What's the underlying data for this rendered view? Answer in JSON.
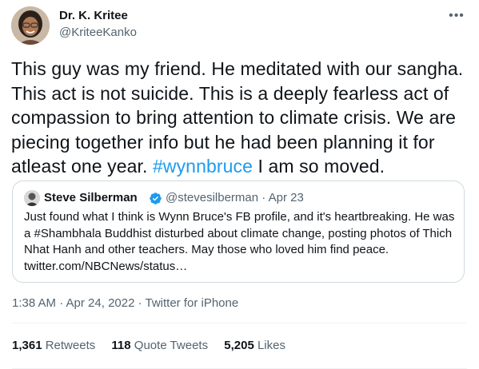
{
  "author": {
    "name": "Dr. K. Kritee",
    "handle": "@KriteeKanko",
    "avatar_icon": "avatar"
  },
  "more_icon": "more-horizontal-icon",
  "tweet": {
    "text_1": "This guy was my friend. He meditated with our sangha. This act is not suicide. This is a deeply fearless act of compassion to bring attention to climate crisis. We are piecing together info but he had been planning it for atleast one year. ",
    "hashtag": "#wynnbruce",
    "text_2": " I am so moved."
  },
  "quoted": {
    "name": "Steve Silberman",
    "handle_date": "@stevesilberman · Apr 23",
    "text": "Just found what I think is Wynn Bruce's FB profile, and it's heartbreaking. He was a #Shambhala Buddhist disturbed about climate change, posting photos of Thich Nhat Hanh and other teachers. May those who loved him find peace. twitter.com/NBCNews/status…"
  },
  "meta": {
    "timestamp": "1:38 AM · Apr 24, 2022 · Twitter for iPhone"
  },
  "stats": {
    "retweets_count": "1,361",
    "retweets_label": "Retweets",
    "quotes_count": "118",
    "quotes_label": "Quote Tweets",
    "likes_count": "5,205",
    "likes_label": "Likes"
  },
  "colors": {
    "link": "#1d9bf0",
    "secondary": "#536471",
    "text": "#0f1419",
    "border": "#cfd9de"
  }
}
